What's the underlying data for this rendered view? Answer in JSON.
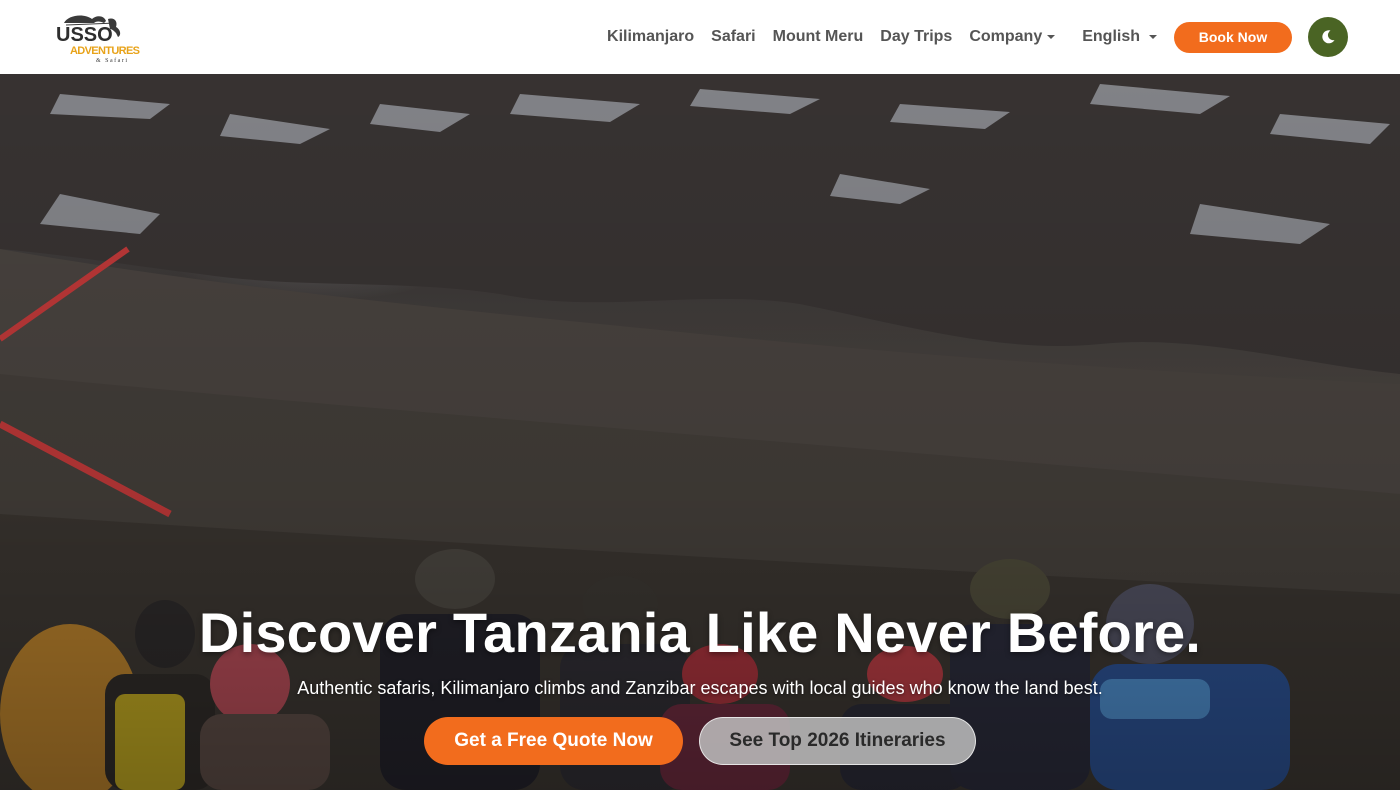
{
  "brand": {
    "logo_text_top": "USSO",
    "logo_text_bottom": "ADVENTURES",
    "logo_text_tag": "& Safari",
    "colors": {
      "orange": "#f26c1d",
      "green": "#4a6424",
      "text": "#555555"
    }
  },
  "nav": {
    "items": [
      {
        "label": "Kilimanjaro"
      },
      {
        "label": "Safari"
      },
      {
        "label": "Mount Meru"
      },
      {
        "label": "Day Trips"
      },
      {
        "label": "Company"
      }
    ],
    "language": "English",
    "book_label": "Book Now",
    "theme_icon": "moon-icon"
  },
  "hero": {
    "title": "Discover Tanzania Like Never Before.",
    "subtitle": "Authentic safaris, Kilimanjaro climbs and Zanzibar escapes with local guides who know the land best.",
    "primary_cta": "Get a Free Quote Now",
    "secondary_cta": "See Top 2026 Itineraries"
  }
}
